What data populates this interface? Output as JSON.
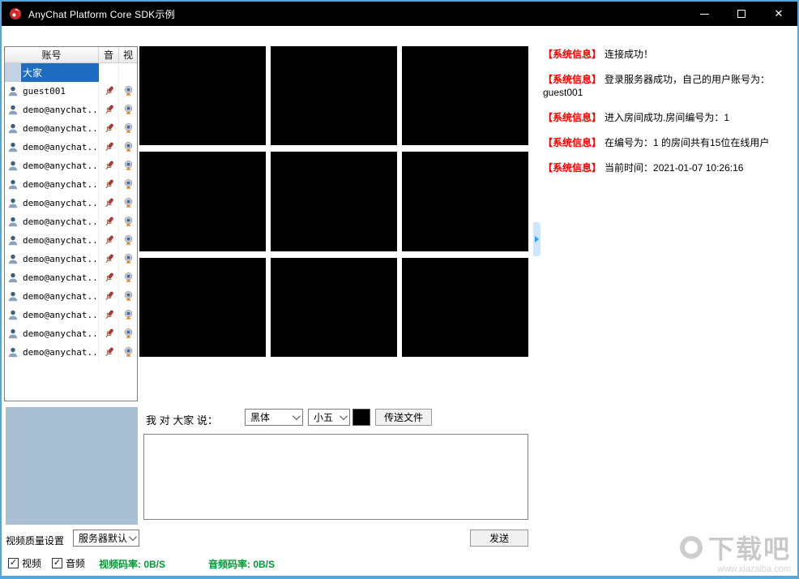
{
  "window": {
    "title": "AnyChat Platform Core SDK示例"
  },
  "user_list": {
    "header": {
      "account": "账号",
      "audio": "音",
      "video": "视"
    },
    "rows": [
      {
        "name": "大家",
        "type": "group"
      },
      {
        "name": "guest001",
        "type": "user"
      },
      {
        "name": "demo@anychat...",
        "type": "user"
      },
      {
        "name": "demo@anychat...",
        "type": "user"
      },
      {
        "name": "demo@anychat...",
        "type": "user"
      },
      {
        "name": "demo@anychat...",
        "type": "user"
      },
      {
        "name": "demo@anychat...",
        "type": "user"
      },
      {
        "name": "demo@anychat...",
        "type": "user"
      },
      {
        "name": "demo@anychat...",
        "type": "user"
      },
      {
        "name": "demo@anychat...",
        "type": "user"
      },
      {
        "name": "demo@anychat...",
        "type": "user"
      },
      {
        "name": "demo@anychat...",
        "type": "user"
      },
      {
        "name": "demo@anychat...",
        "type": "user"
      },
      {
        "name": "demo@anychat...",
        "type": "user"
      },
      {
        "name": "demo@anychat...",
        "type": "user"
      },
      {
        "name": "demo@anychat...",
        "type": "user"
      }
    ]
  },
  "video_grid": {
    "cells": 9
  },
  "system_messages": [
    {
      "tag": "【系统信息】",
      "text": "连接成功！"
    },
    {
      "tag": "【系统信息】",
      "text": "登录服务器成功，自己的用户账号为：guest001"
    },
    {
      "tag": "【系统信息】",
      "text": "进入房间成功.房间编号为：1"
    },
    {
      "tag": "【系统信息】",
      "text": "在编号为：1 的房间共有15位在线用户"
    },
    {
      "tag": "【系统信息】",
      "text": "当前时间：2021-01-07 10:26:16"
    }
  ],
  "chat": {
    "say_label": "我 对 大家 说：",
    "font_name": "黑体",
    "font_size": "小五",
    "send_file": "传送文件",
    "send": "发送",
    "message_value": ""
  },
  "settings": {
    "quality_label": "视频质量设置",
    "quality_value": "服务器默认",
    "video_check": "视频",
    "audio_check": "音频",
    "video_bitrate_label": "视频码率:",
    "video_bitrate_value": "0B/S",
    "audio_bitrate_label": "音频码率:",
    "audio_bitrate_value": "0B/S"
  },
  "watermark": {
    "title": "下载吧",
    "url": "www.xiazaiba.com"
  },
  "colors": {
    "selection_blue": "#1f6bc0",
    "message_tag_red": "#ff0000",
    "bitrate_green": "#009933",
    "preview_bg": "#a9bfd3",
    "titlebar": "#000000",
    "window_border": "#53a7da"
  }
}
